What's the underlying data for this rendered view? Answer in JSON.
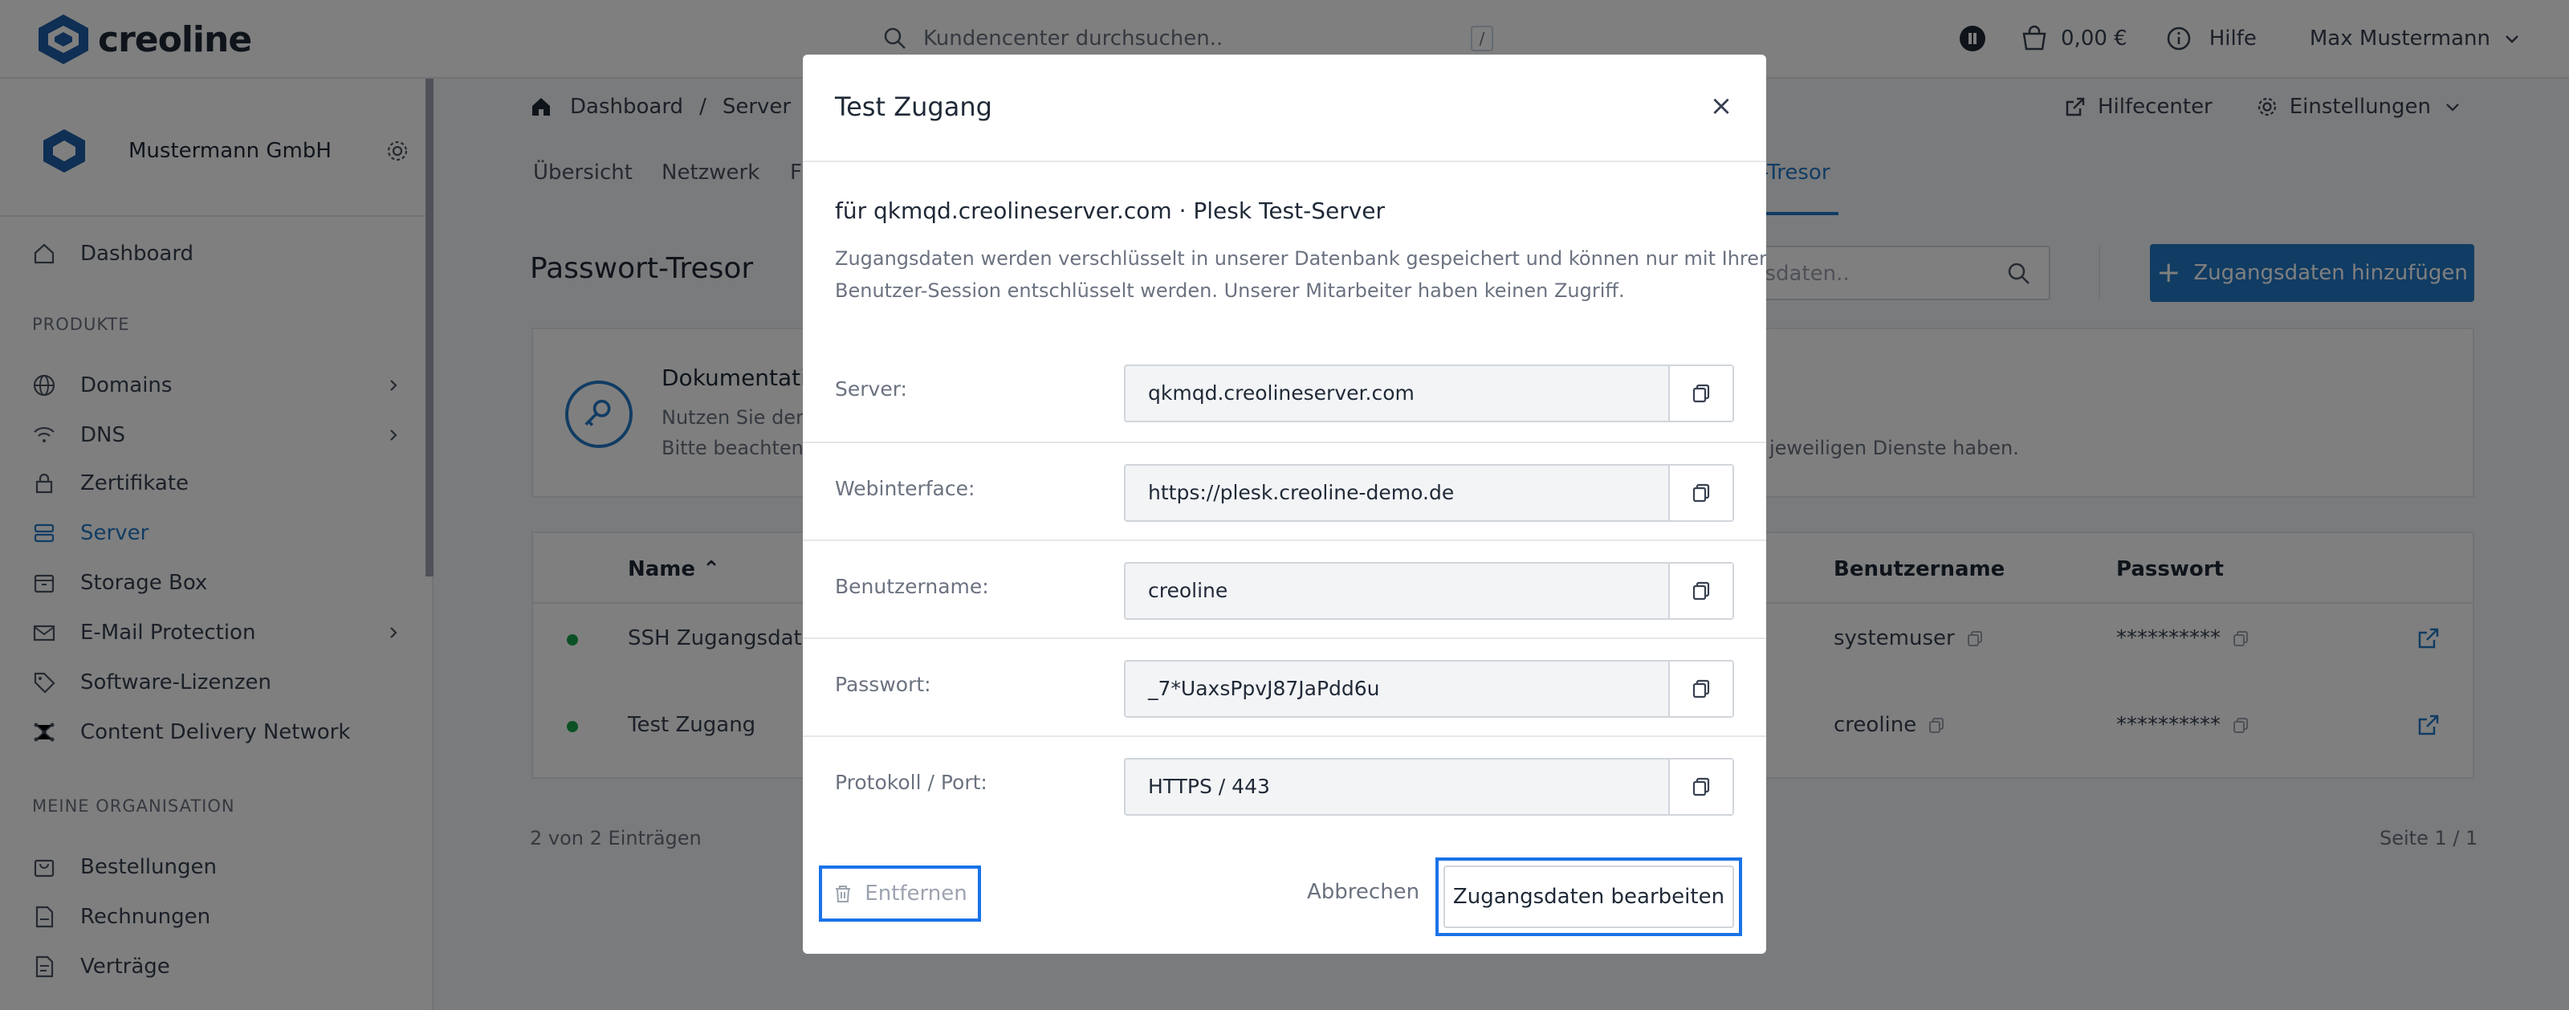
{
  "header": {
    "logo_text": "creoline",
    "search_placeholder": "Kundencenter durchsuchen..",
    "search_shortcut": "/",
    "cart_amount": "0,00 €",
    "help_label": "Hilfe",
    "user_name": "Max Mustermann"
  },
  "sidebar": {
    "org_name": "Mustermann GmbH",
    "dashboard_label": "Dashboard",
    "section_products": "PRODUKTE",
    "products": [
      {
        "label": "Domains",
        "icon": "globe-icon",
        "has_children": true
      },
      {
        "label": "DNS",
        "icon": "wifi-icon",
        "has_children": true
      },
      {
        "label": "Zertifikate",
        "icon": "lock-icon",
        "has_children": false
      },
      {
        "label": "Server",
        "icon": "server-icon",
        "has_children": false,
        "active": true
      },
      {
        "label": "Storage Box",
        "icon": "box-icon",
        "has_children": false
      },
      {
        "label": "E-Mail Protection",
        "icon": "mail-icon",
        "has_children": true
      },
      {
        "label": "Software-Lizenzen",
        "icon": "tag-icon",
        "has_children": false
      },
      {
        "label": "Content Delivery Network",
        "icon": "network-icon",
        "has_children": false
      }
    ],
    "section_org": "MEINE ORGANISATION",
    "org_items": [
      {
        "label": "Bestellungen",
        "icon": "shopping-bag-icon"
      },
      {
        "label": "Rechnungen",
        "icon": "invoice-icon"
      },
      {
        "label": "Verträge",
        "icon": "contract-icon"
      }
    ]
  },
  "main": {
    "breadcrumb": [
      "Dashboard",
      "Server"
    ],
    "help_center": "Hilfecenter",
    "settings": "Einstellungen",
    "tabs": [
      "Übersicht",
      "Netzwerk",
      "F",
      "t-Tresor"
    ],
    "page_title": "Passwort-Tresor",
    "search_placeholder": "gsdaten..",
    "add_button": "Zugangsdaten hinzufügen",
    "doc_title": "Dokumentati",
    "doc_text1": "Nutzen Sie den",
    "doc_text2": "Bitte beachten",
    "doc_text_right": "jeweiligen Dienste haben.",
    "table": {
      "col_name": "Name",
      "col_user": "Benutzername",
      "col_pass": "Passwort",
      "rows": [
        {
          "name": "SSH Zugangsdaten",
          "user": "systemuser",
          "pass": "**********"
        },
        {
          "name": "Test Zugang",
          "user": "creoline",
          "pass": "**********"
        }
      ]
    },
    "count_text": "2 von 2 Einträgen",
    "page_text": "Seite 1 / 1"
  },
  "modal": {
    "title": "Test Zugang",
    "subtitle": "für qkmqd.creolineserver.com · Plesk Test-Server",
    "desc1": "Zugangsdaten werden verschlüsselt in unserer Datenbank gespeichert und können nur mit Ihrer",
    "desc2": "Benutzer-Session entschlüsselt werden. Unserer Mitarbeiter haben keinen Zugriff.",
    "fields": [
      {
        "label": "Server:",
        "value": "qkmqd.creolineserver.com"
      },
      {
        "label": "Webinterface:",
        "value": "https://plesk.creoline-demo.de"
      },
      {
        "label": "Benutzername:",
        "value": "creoline"
      },
      {
        "label": "Passwort:",
        "value": "_7*UaxsPpvJ87JaPdd6u"
      },
      {
        "label": "Protokoll / Port:",
        "value": "HTTPS / 443"
      }
    ],
    "remove_label": "Entfernen",
    "cancel_label": "Abbrechen",
    "edit_label": "Zugangsdaten bearbeiten",
    "close_glyph": "×"
  },
  "colors": {
    "accent": "#2379c7",
    "status_active": "#16a34a",
    "highlight_border": "#1a73e8"
  }
}
